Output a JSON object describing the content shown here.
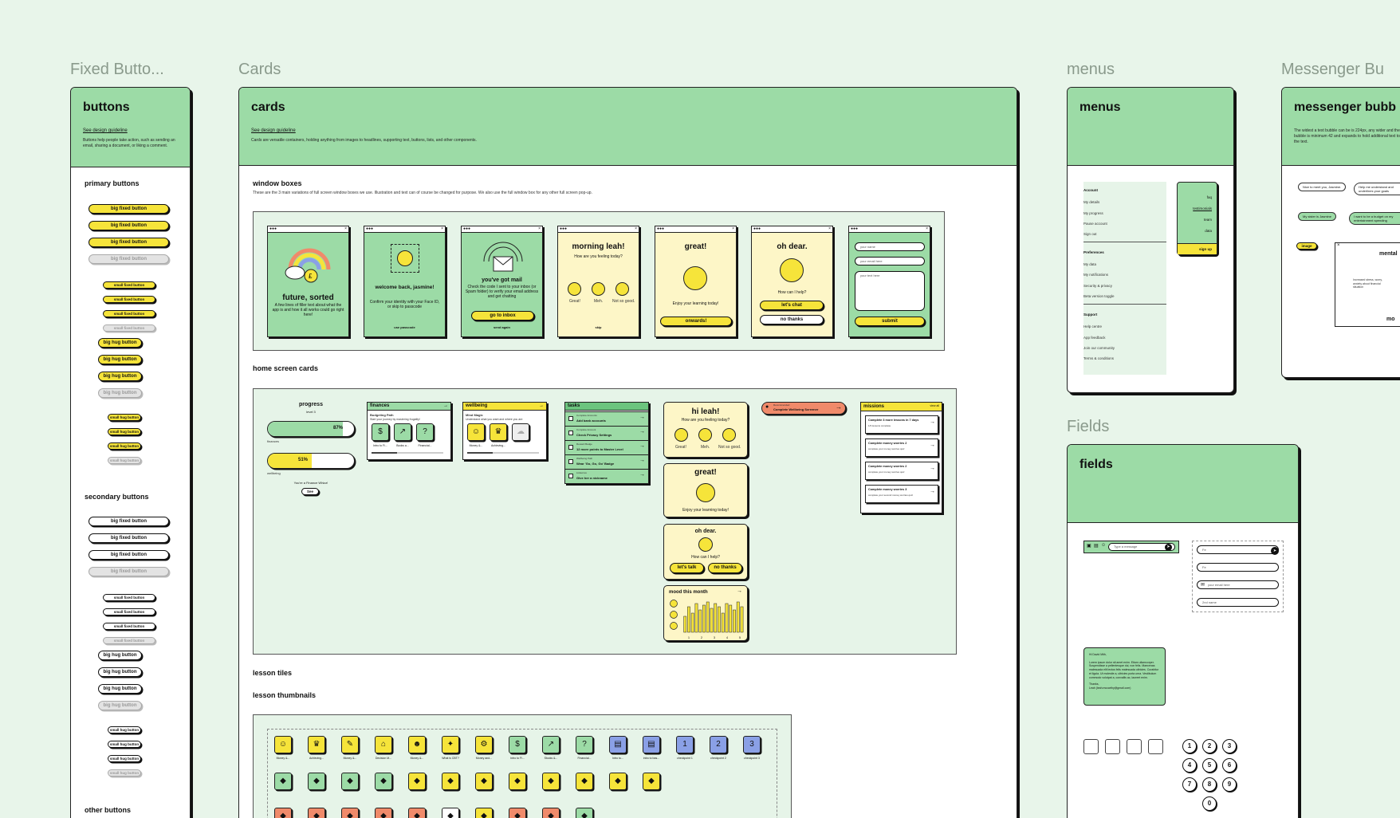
{
  "frame_titles": {
    "fixed_buttons": "Fixed Butto...",
    "cards": "Cards",
    "menus": "menus",
    "messenger": "Messenger Bu",
    "fields": "Fields"
  },
  "buttons_frame": {
    "title": "buttons",
    "link": "See design guideline",
    "description": "Buttons help people take action, such as sending an email, sharing a document, or liking a comment.",
    "primary_heading": "primary buttons",
    "secondary_heading": "secondary buttons",
    "other_heading": "other buttons",
    "big_fixed": "big fixed button",
    "small_fixed": "small fixed button",
    "big_hug": "big hug button",
    "small_hug": "small hug button"
  },
  "cards_frame": {
    "title": "cards",
    "link": "See design guideline",
    "description": "Cards are versatile containers, holding anything from images to headlines, supporting text, buttons, lists, and other components.",
    "window_boxes_heading": "window boxes",
    "window_boxes_desc": "These are the 3 main variations of full screen window boxes we use. Illustration and text can of course be changed for purpose. We also use the full window box for any other full screen pop-up.",
    "home_cards_heading": "home screen cards",
    "lesson_tiles_heading": "lesson tiles",
    "lesson_thumbs_heading": "lesson thumbnails",
    "window_boxes": [
      {
        "title": "future, sorted",
        "text": "A few lines of filler text about what the app is and how it all works could go right here!"
      },
      {
        "title": "welcome back, jasmine!",
        "text": "Confirm your identity with your Face ID, or skip to passcode",
        "link": "use passcode"
      },
      {
        "title": "you've got mail",
        "text": "Check the code I sent to your inbox (or Spam folder) to verify your email address and get chatting",
        "button": "go to inbox",
        "link": "send again"
      },
      {
        "title": "morning leah!",
        "text": "How are you feeling today?",
        "faces": [
          "Great!",
          "Meh.",
          "Not so good."
        ],
        "link": "skip"
      },
      {
        "title": "great!",
        "text": "Enjoy your learning today!",
        "button": "onwards!"
      },
      {
        "title": "oh dear.",
        "text": "How can I help?",
        "button": "let's chat",
        "button2": "no thanks"
      },
      {
        "field1": "your name",
        "field2": "your email here",
        "field3": "your text here",
        "button": "submit"
      }
    ],
    "progress": {
      "title": "progress",
      "level": "level 3",
      "finance_pct": "87%",
      "finance_label": "finances",
      "wellbeing_pct": "51%",
      "wellbeing_label": "wellbeing",
      "note": "You're a Finance Whizz!",
      "button": "See"
    },
    "finances_card": {
      "title": "finances",
      "sub": "Budgeting Path",
      "desc": "Start your journey by mastering frugality!",
      "items": [
        "Intro to Fi...",
        "Books a...",
        "Financial..."
      ]
    },
    "wellbeing_card": {
      "title": "wellbeing",
      "sub": "Mind Magic",
      "desc": "Understand what you want and where you are",
      "items": [
        "Money &...",
        "Achieving...",
        ""
      ]
    },
    "tasks": {
      "title": "tasks",
      "items": [
        {
          "cat": "Complete Accounts",
          "text": "Add bank accounts"
        },
        {
          "cat": "Complete Account",
          "text": "Check Privacy Settings"
        },
        {
          "cat": "Reward Badge",
          "text": "12 more points to Master Level"
        },
        {
          "cat": "Wellbeing Path",
          "text": "Wear 'Go, Go, Go' Badge"
        },
        {
          "cat": "Linked as",
          "text": "Give her a nickname"
        }
      ]
    },
    "hi_card": {
      "title": "hi leah!",
      "text": "How are you feeling today?",
      "faces": [
        "Great!",
        "Meh.",
        "Not so good."
      ]
    },
    "great_card": {
      "title": "great!",
      "text": "Enjoy your learning today!"
    },
    "ohdear_card": {
      "title": "oh dear.",
      "text": "How can I help?",
      "button": "let's talk",
      "button2": "no thanks"
    },
    "mood_card": {
      "title": "mood this month",
      "values": [
        0.5,
        0.8,
        0.6,
        0.9,
        0.7,
        0.85,
        0.95,
        0.75,
        0.9,
        0.8,
        0.6,
        0.9,
        0.85,
        0.7,
        0.95,
        0.8
      ],
      "ticks": [
        "1",
        "2",
        "3",
        "4",
        "5"
      ]
    },
    "alert": {
      "label": "Recommended",
      "text": "Complete Wellbeing Screener"
    },
    "missions": {
      "title": "missions",
      "viewall": "view all",
      "items": [
        {
          "title": "Complete 3 more lessons in 7 days",
          "sub": "1/3 lessons complete"
        },
        {
          "title": "Complete money worries 2",
          "sub": "complete your money worries quiz"
        },
        {
          "title": "Complete money worries 2",
          "sub": "complete your money worries quiz"
        },
        {
          "title": "Complete money worries 3",
          "sub": "complete your second money worries quiz"
        }
      ]
    },
    "thumbnails_row1": [
      "Money &...",
      "Achieving...",
      "Money &...",
      "Decision M...",
      "Money &...",
      "What is CBT?",
      "Money and...",
      "Intro to Fi...",
      "Stocks &...",
      "Financial...",
      "Intro to...",
      "intro to bas...",
      "checkpoint 1",
      "checkpoint 2",
      "checkpoint 3"
    ]
  },
  "menus_frame": {
    "title": "menus",
    "account_heading": "Account",
    "account_items": [
      "My details",
      "My progress",
      "Pause account",
      "Sign out"
    ],
    "pref_heading": "Preferences",
    "pref_items": [
      "My data",
      "My notifications",
      "Security & privacy",
      "Beta version toggle"
    ],
    "support_heading": "Support",
    "support_items": [
      "Help centre",
      "App feedback",
      "Join our community",
      "Terms & conditions"
    ],
    "side_items": [
      "faq",
      "testimonials",
      "team",
      "data"
    ],
    "side_button": "sign up"
  },
  "messenger_frame": {
    "title": "messenger bubb",
    "description": "The widest a text bubble can be is 224px, any wider and the bubble is minimum 42 and expands to hold additional text to fill the text.",
    "bubble1": "Nice to meet you, Jasmine.",
    "bubble2": "Help me understand and underlines your goals",
    "bubble3": "My sister is Jasmine",
    "bubble4": "I want to be a budget on my entertainment spending",
    "image_btn": "image",
    "popup_title": "mental",
    "popup_text": "Increased stress, worry, anxiety about financial situation",
    "popup_more": "mo"
  },
  "fields_frame": {
    "title": "fields",
    "msg_placeholder": "Type a message",
    "field_values": [
      "Fe",
      "Fe",
      "your email here",
      "2nd name"
    ],
    "letter_lines": [
      "Hi David Mith,",
      "Lorem ipsum dolor sit amet enim. Etiam ullamcorper. Suspendisse a pellentesque dui, non felis. Maecenas malesuada elit lectus felis malesuada ultricies. Curabitur et ligula. Ut molestie a, ultricies porta urna. Vestibulum commodo volutpat a, convallis ac, laoreet enim.",
      "Thanks,",
      "Leah (leah.mccarthy@gmail.com)"
    ],
    "keypad": [
      "1",
      "2",
      "3",
      "4",
      "5",
      "6",
      "7",
      "8",
      "9",
      "0"
    ]
  },
  "colors": {
    "background": "#e8f5ea",
    "header_green": "#9cdba6",
    "yellow": "#f6e43a",
    "cream": "#fdf6c7",
    "orange": "#f08a6a",
    "blue": "#8aa0e6"
  }
}
